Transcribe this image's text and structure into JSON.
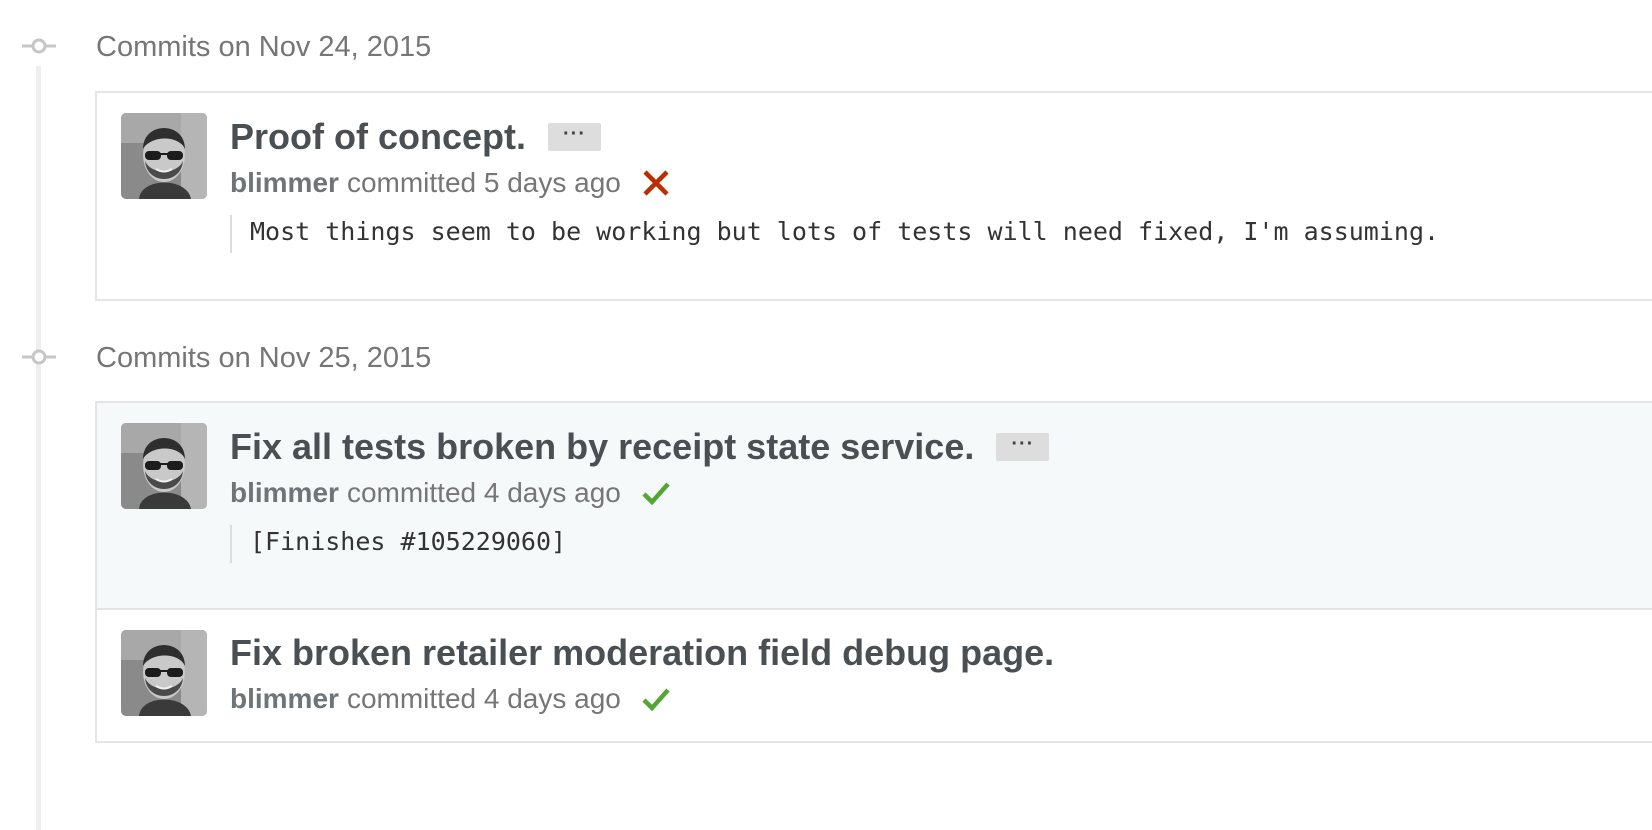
{
  "groups": [
    {
      "title": "Commits on Nov 24, 2015",
      "commits": [
        {
          "title": "Proof of concept.",
          "ellipsis": "···",
          "author": "blimmer",
          "meta": "committed 5 days ago",
          "status": "failure",
          "status_icon": "x-icon",
          "description": "Most things seem to be working but lots of tests will need fixed, I'm assuming."
        }
      ]
    },
    {
      "title": "Commits on Nov 25, 2015",
      "commits": [
        {
          "title": "Fix all tests broken by receipt state service.",
          "ellipsis": "···",
          "author": "blimmer",
          "meta": "committed 4 days ago",
          "status": "success",
          "status_icon": "check-icon",
          "description": "[Finishes #105229060]"
        },
        {
          "title": "Fix broken retailer moderation field debug page.",
          "author": "blimmer",
          "meta": "committed 4 days ago",
          "status": "success",
          "status_icon": "check-icon"
        }
      ]
    }
  ],
  "colors": {
    "failure": "#bd2c00",
    "success": "#55a532",
    "title_text": "#4a4f54",
    "muted_text": "#767676",
    "highlight_bg": "#f6f9fa"
  }
}
